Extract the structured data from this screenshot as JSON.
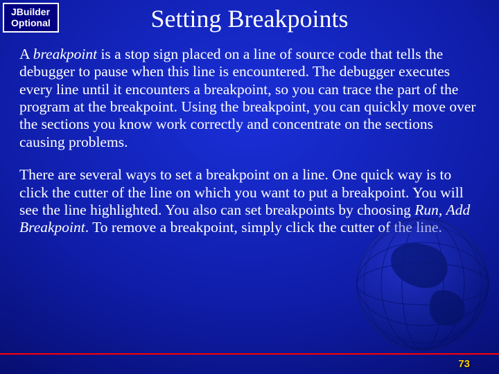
{
  "badge": {
    "line1": "JBuilder",
    "line2": "Optional"
  },
  "title": "Setting Breakpoints",
  "paragraph1": {
    "lead": "A ",
    "term": "breakpoint",
    "rest": " is a stop sign placed on a line of source code that tells the debugger to pause when this line is encountered. The debugger executes every line until it encounters a breakpoint, so you can trace the part of the program at the breakpoint. Using the breakpoint, you can quickly move over the sections you know work correctly and concentrate on the sections causing problems."
  },
  "paragraph2": {
    "part1": "There are several ways to set a breakpoint on a line. One quick way is to click the cutter of the line on which you want to put a breakpoint. You will see the line highlighted. You also can set breakpoints by choosing ",
    "menu1": "Run",
    "comma": ", ",
    "menu2": "Add Breakpoint",
    "part2": ". To remove a breakpoint, simply click the cutter of the line."
  },
  "page_number": "73"
}
